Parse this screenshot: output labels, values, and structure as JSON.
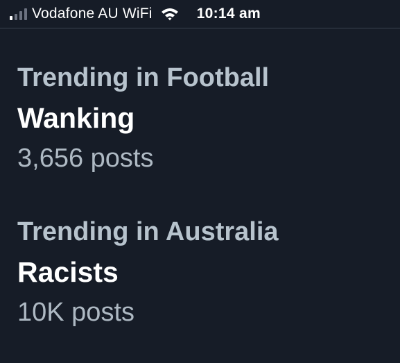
{
  "status_bar": {
    "carrier": "Vodafone AU WiFi",
    "time": "10:14 am",
    "signal_bars_active": 1,
    "signal_bars_total": 4,
    "icons": [
      "signal-icon",
      "wifi-icon"
    ]
  },
  "trends": [
    {
      "context": "Trending in Football",
      "topic": "Wanking",
      "posts": "3,656 posts"
    },
    {
      "context": "Trending in Australia",
      "topic": "Racists",
      "posts": "10K posts"
    }
  ],
  "colors": {
    "background": "#161c27",
    "context_text": "#b7c3cd",
    "topic_text": "#ffffff",
    "count_text": "#aeb9c3"
  }
}
